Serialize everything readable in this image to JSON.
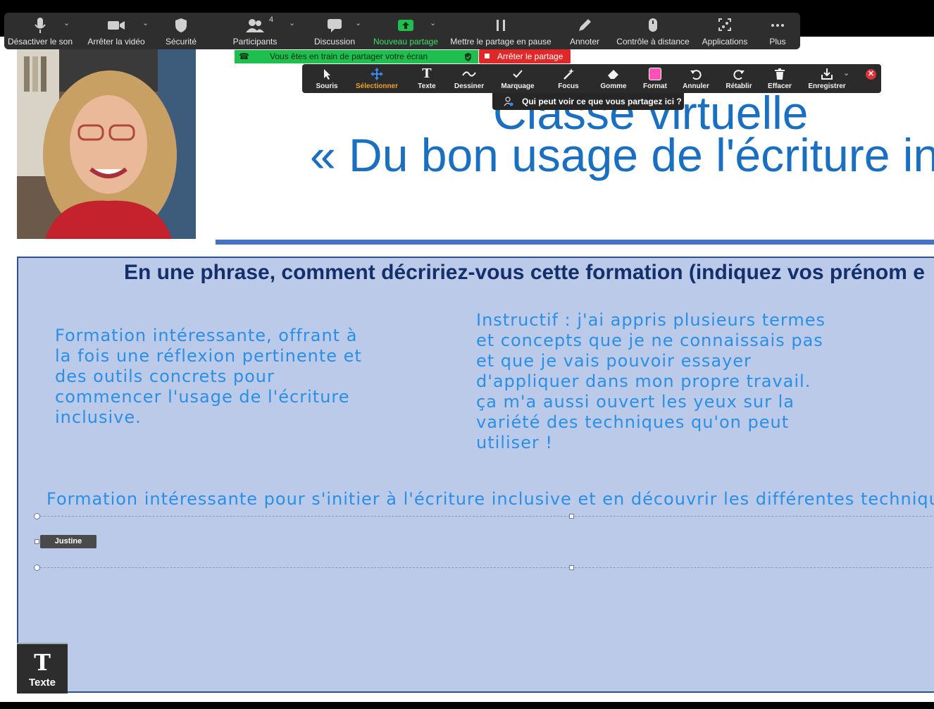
{
  "zoom_toolbar": {
    "mute": "Désactiver le son",
    "stop_video": "Arrêter la vidéo",
    "security": "Sécurité",
    "participants": "Participants",
    "participants_count": "4",
    "chat": "Discussion",
    "new_share": "Nouveau partage",
    "pause_share": "Mettre le partage en pause",
    "annotate": "Annoter",
    "remote_control": "Contrôle à distance",
    "apps": "Applications",
    "more": "Plus"
  },
  "share_status": {
    "text": "Vous êtes en train de partager votre écran",
    "stop": "Arrêter le partage",
    "who_sees": "Qui peut voir ce que vous partagez ici ?"
  },
  "annotation_toolbar": {
    "mouse": "Souris",
    "select": "Sélectionner",
    "text": "Texte",
    "draw": "Dessiner",
    "stamp": "Marquage",
    "spotlight": "Focus",
    "eraser": "Gomme",
    "format": "Format",
    "undo": "Annuler",
    "redo": "Rétablir",
    "clear": "Effacer",
    "save": "Enregistrer",
    "accent_color": "#ff4fb8",
    "selected_color": "#f0a030"
  },
  "slide": {
    "title_line1": "Classe virtuelle",
    "title_line2": "« Du bon usage de l'écriture incl",
    "question": "En une phrase, comment décririez-vous cette formation (indiquez vos prénom e",
    "answers": [
      "Formation intéressante, offrant à la fois une réflexion pertinente et des outils concrets pour commencer l'usage de l'écriture inclusive.",
      "Instructif : j'ai appris plusieurs termes et concepts que je ne connaissais pas et que je vais pouvoir essayer d'appliquer dans mon propre travail. ça m'a aussi ouvert les yeux sur la variété des techniques qu'on peut utiliser !",
      "Formation intéressante pour s'initier à l'écriture inclusive et en découvrir les différentes techniques"
    ],
    "author_tag": "Justine",
    "text_tool_label": "Texte"
  }
}
